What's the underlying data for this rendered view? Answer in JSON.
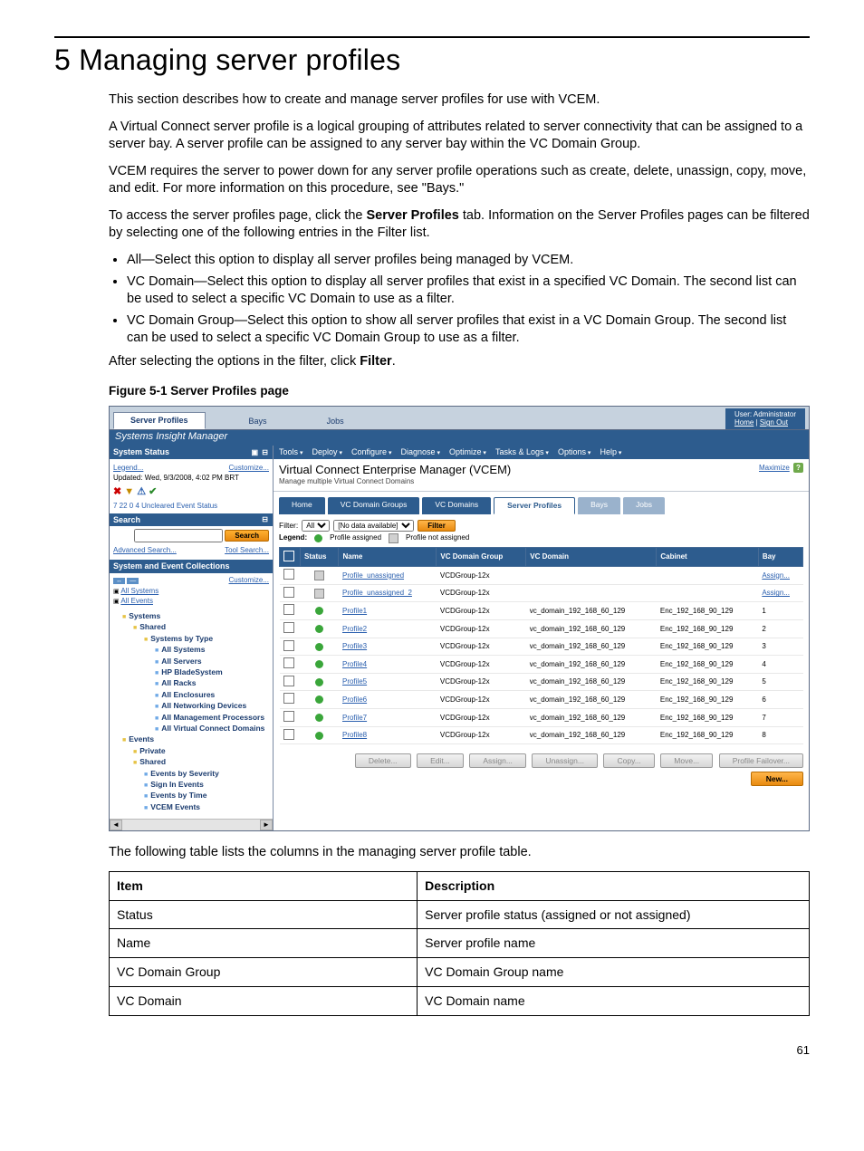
{
  "heading": "5 Managing server profiles",
  "intro": {
    "p1": "This section describes how to create and manage server profiles for use with VCEM.",
    "p2": "A Virtual Connect server profile is a logical grouping of attributes related to server connectivity that can be assigned to a server bay. A server profile can be assigned to any server bay within the VC Domain Group.",
    "p3": "VCEM requires the server to power down for any server profile operations such as create, delete, unassign, copy, move, and edit. For more information on this procedure, see \"Bays.\"",
    "p4a": "To access the server profiles page, click the ",
    "p4b": "Server Profiles",
    "p4c": " tab. Information on the Server Profiles pages can be filtered by selecting one of the following entries in the Filter list.",
    "b1": "All—Select this option to display all server profiles being managed by VCEM.",
    "b2": "VC Domain—Select this option to display all server profiles that exist in a specified VC Domain. The second list can be used to select a specific VC Domain to use as a filter.",
    "b3": "VC Domain Group—Select this option to show all server profiles that exist in a VC Domain Group. The second list can be used to select a specific VC Domain Group to use as a filter.",
    "p5a": "After selecting the options in the filter, click ",
    "p5b": "Filter",
    "p5c": "."
  },
  "figcap": "Figure 5-1 Server Profiles page",
  "shot": {
    "topTabs": {
      "t1": "Server Profiles",
      "t2": "Bays",
      "t3": "Jobs"
    },
    "user": {
      "label": "User: Administrator",
      "home": "Home",
      "signout": "Sign Out"
    },
    "brand": "Systems Insight Manager",
    "left": {
      "sysstatus": "System Status",
      "legend": "Legend...",
      "customize": "Customize...",
      "updated": "Updated: Wed, 9/3/2008, 4:02 PM BRT",
      "counts": "7   22   0   4  Uncleared Event Status",
      "search": "Search",
      "searchbtn": "Search",
      "adv": "Advanced Search...",
      "tool": "Tool Search...",
      "collections": "System and Event Collections",
      "allsys": "All Systems",
      "allev": "All Events",
      "tree": {
        "n1": "Systems",
        "n1a": "Shared",
        "n1a1": "Systems by Type",
        "l1": "All Systems",
        "l2": "All Servers",
        "l3": "HP BladeSystem",
        "l4": "All Racks",
        "l5": "All Enclosures",
        "l6": "All Networking Devices",
        "l7": "All Management Processors",
        "l8": "All Virtual Connect Domains",
        "n2": "Events",
        "n2a": "Private",
        "n2b": "Shared",
        "l9": "Events by Severity",
        "l10": "Sign In Events",
        "l11": "Events by Time",
        "l12": "VCEM Events"
      }
    },
    "menus": {
      "m1": "Tools",
      "m2": "Deploy",
      "m3": "Configure",
      "m4": "Diagnose",
      "m5": "Optimize",
      "m6": "Tasks & Logs",
      "m7": "Options",
      "m8": "Help"
    },
    "title": "Virtual Connect Enterprise Manager (VCEM)",
    "subtitle": "Manage multiple Virtual Connect Domains",
    "maximize": "Maximize",
    "innerTabs": {
      "t1": "Home",
      "t2": "VC Domain Groups",
      "t3": "VC Domains",
      "t4": "Server Profiles",
      "t5": "Bays",
      "t6": "Jobs"
    },
    "filter": {
      "label": "Filter:",
      "val": "All",
      "nodata": "[No data available]",
      "btn": "Filter"
    },
    "legend": {
      "label": "Legend:",
      "a": "Profile assigned",
      "b": "Profile not assigned"
    },
    "cols": {
      "c1": "Status",
      "c2": "Name",
      "c3": "VC Domain Group",
      "c4": "VC Domain",
      "c5": "Cabinet",
      "c6": "Bay"
    },
    "rows": [
      {
        "status": "grey",
        "name": "Profile_unassigned",
        "group": "VCDGroup-12x",
        "domain": "",
        "cab": "",
        "bay": "Assign..."
      },
      {
        "status": "grey",
        "name": "Profile_unassigned_2",
        "group": "VCDGroup-12x",
        "domain": "",
        "cab": "",
        "bay": "Assign..."
      },
      {
        "status": "green",
        "name": "Profile1",
        "group": "VCDGroup-12x",
        "domain": "vc_domain_192_168_60_129",
        "cab": "Enc_192_168_90_129",
        "bay": "1"
      },
      {
        "status": "green",
        "name": "Profile2",
        "group": "VCDGroup-12x",
        "domain": "vc_domain_192_168_60_129",
        "cab": "Enc_192_168_90_129",
        "bay": "2"
      },
      {
        "status": "green",
        "name": "Profile3",
        "group": "VCDGroup-12x",
        "domain": "vc_domain_192_168_60_129",
        "cab": "Enc_192_168_90_129",
        "bay": "3"
      },
      {
        "status": "green",
        "name": "Profile4",
        "group": "VCDGroup-12x",
        "domain": "vc_domain_192_168_60_129",
        "cab": "Enc_192_168_90_129",
        "bay": "4"
      },
      {
        "status": "green",
        "name": "Profile5",
        "group": "VCDGroup-12x",
        "domain": "vc_domain_192_168_60_129",
        "cab": "Enc_192_168_90_129",
        "bay": "5"
      },
      {
        "status": "green",
        "name": "Profile6",
        "group": "VCDGroup-12x",
        "domain": "vc_domain_192_168_60_129",
        "cab": "Enc_192_168_90_129",
        "bay": "6"
      },
      {
        "status": "green",
        "name": "Profile7",
        "group": "VCDGroup-12x",
        "domain": "vc_domain_192_168_60_129",
        "cab": "Enc_192_168_90_129",
        "bay": "7"
      },
      {
        "status": "green",
        "name": "Profile8",
        "group": "VCDGroup-12x",
        "domain": "vc_domain_192_168_60_129",
        "cab": "Enc_192_168_90_129",
        "bay": "8"
      }
    ],
    "btns": {
      "b1": "Delete...",
      "b2": "Edit...",
      "b3": "Assign...",
      "b4": "Unassign...",
      "b5": "Copy...",
      "b6": "Move...",
      "b7": "Profile Failover...",
      "b8": "New..."
    }
  },
  "afterShot": "The following table lists the columns in the managing server profile table.",
  "desc": {
    "h1": "Item",
    "h2": "Description",
    "r": [
      [
        "Status",
        "Server profile status (assigned or not assigned)"
      ],
      [
        "Name",
        "Server profile name"
      ],
      [
        "VC Domain Group",
        "VC Domain Group name"
      ],
      [
        "VC Domain",
        "VC Domain name"
      ]
    ]
  },
  "pagenum": "61"
}
